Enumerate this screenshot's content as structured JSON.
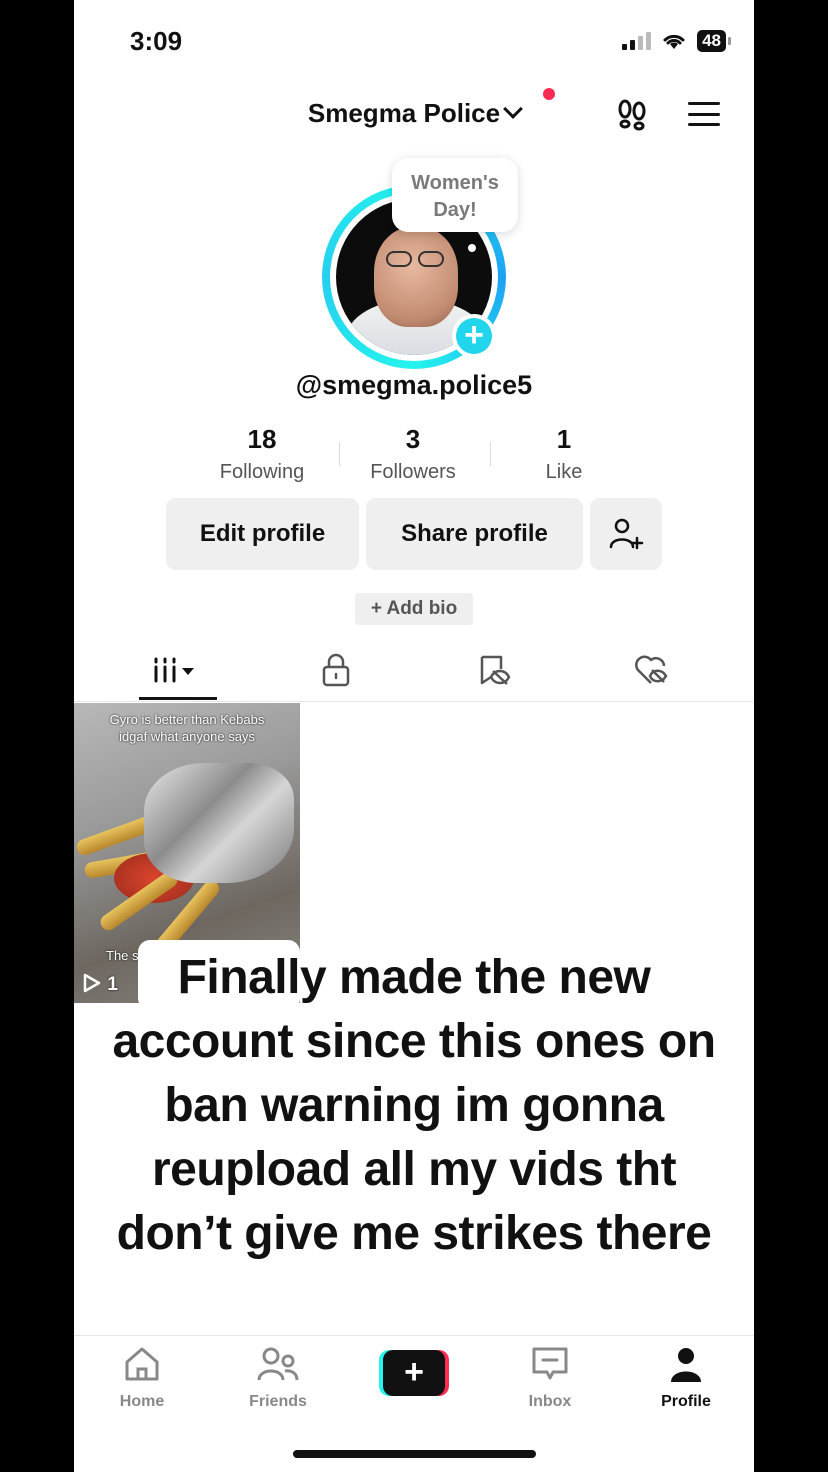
{
  "status_bar": {
    "time": "3:09",
    "battery": "48"
  },
  "header": {
    "account_name": "Smegma Police"
  },
  "avatar": {
    "bubble_text_line1": "Women's",
    "bubble_text_line2": "Day!"
  },
  "profile": {
    "username": "@smegma.police5"
  },
  "stats": [
    {
      "value": "18",
      "label": "Following"
    },
    {
      "value": "3",
      "label": "Followers"
    },
    {
      "value": "1",
      "label": "Like"
    }
  ],
  "buttons": {
    "edit": "Edit profile",
    "share": "Share profile",
    "add_bio": "+ Add bio"
  },
  "tabs": [
    "videos-grid-icon",
    "lock-icon",
    "eye-slash-icon",
    "heart-slash-icon"
  ],
  "video": {
    "caption_line1": "Gyro is better than Kebabs",
    "caption_line2": "idgaf what anyone says",
    "bottom_text": "The s",
    "views": "1"
  },
  "overlay_caption": {
    "line1": "Finally made the new",
    "line2": "account since this ones on",
    "line3": "ban warning im gonna",
    "line4": "reupload all my vids tht",
    "line5": "don’t give me strikes there"
  },
  "nav": [
    {
      "label": "Home",
      "icon": "home-icon"
    },
    {
      "label": "Friends",
      "icon": "friends-icon"
    },
    {
      "label": "",
      "icon": "create-icon"
    },
    {
      "label": "Inbox",
      "icon": "inbox-icon"
    },
    {
      "label": "Profile",
      "icon": "profile-icon"
    }
  ],
  "colors": {
    "accent_cyan": "#25f4ee",
    "accent_red": "#fe2c55",
    "badge_blue": "#20d5ec"
  }
}
